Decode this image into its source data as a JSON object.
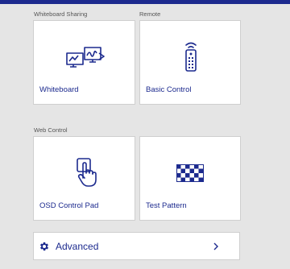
{
  "colors": {
    "accent": "#1c2a8e",
    "background": "#e5e5e5",
    "tile": "#ffffff"
  },
  "sections": {
    "whiteboard_sharing": "Whiteboard Sharing",
    "remote": "Remote",
    "web_control": "Web Control"
  },
  "tiles": {
    "whiteboard": {
      "label": "Whiteboard",
      "icon": "whiteboard-icon"
    },
    "basic_control": {
      "label": "Basic Control",
      "icon": "remote-control-icon"
    },
    "osd_control_pad": {
      "label": "OSD Control Pad",
      "icon": "touch-hand-icon"
    },
    "test_pattern": {
      "label": "Test Pattern",
      "icon": "checkerboard-icon"
    }
  },
  "advanced": {
    "label": "Advanced",
    "icon": "gear-icon",
    "chevron": "chevron-right-icon"
  }
}
